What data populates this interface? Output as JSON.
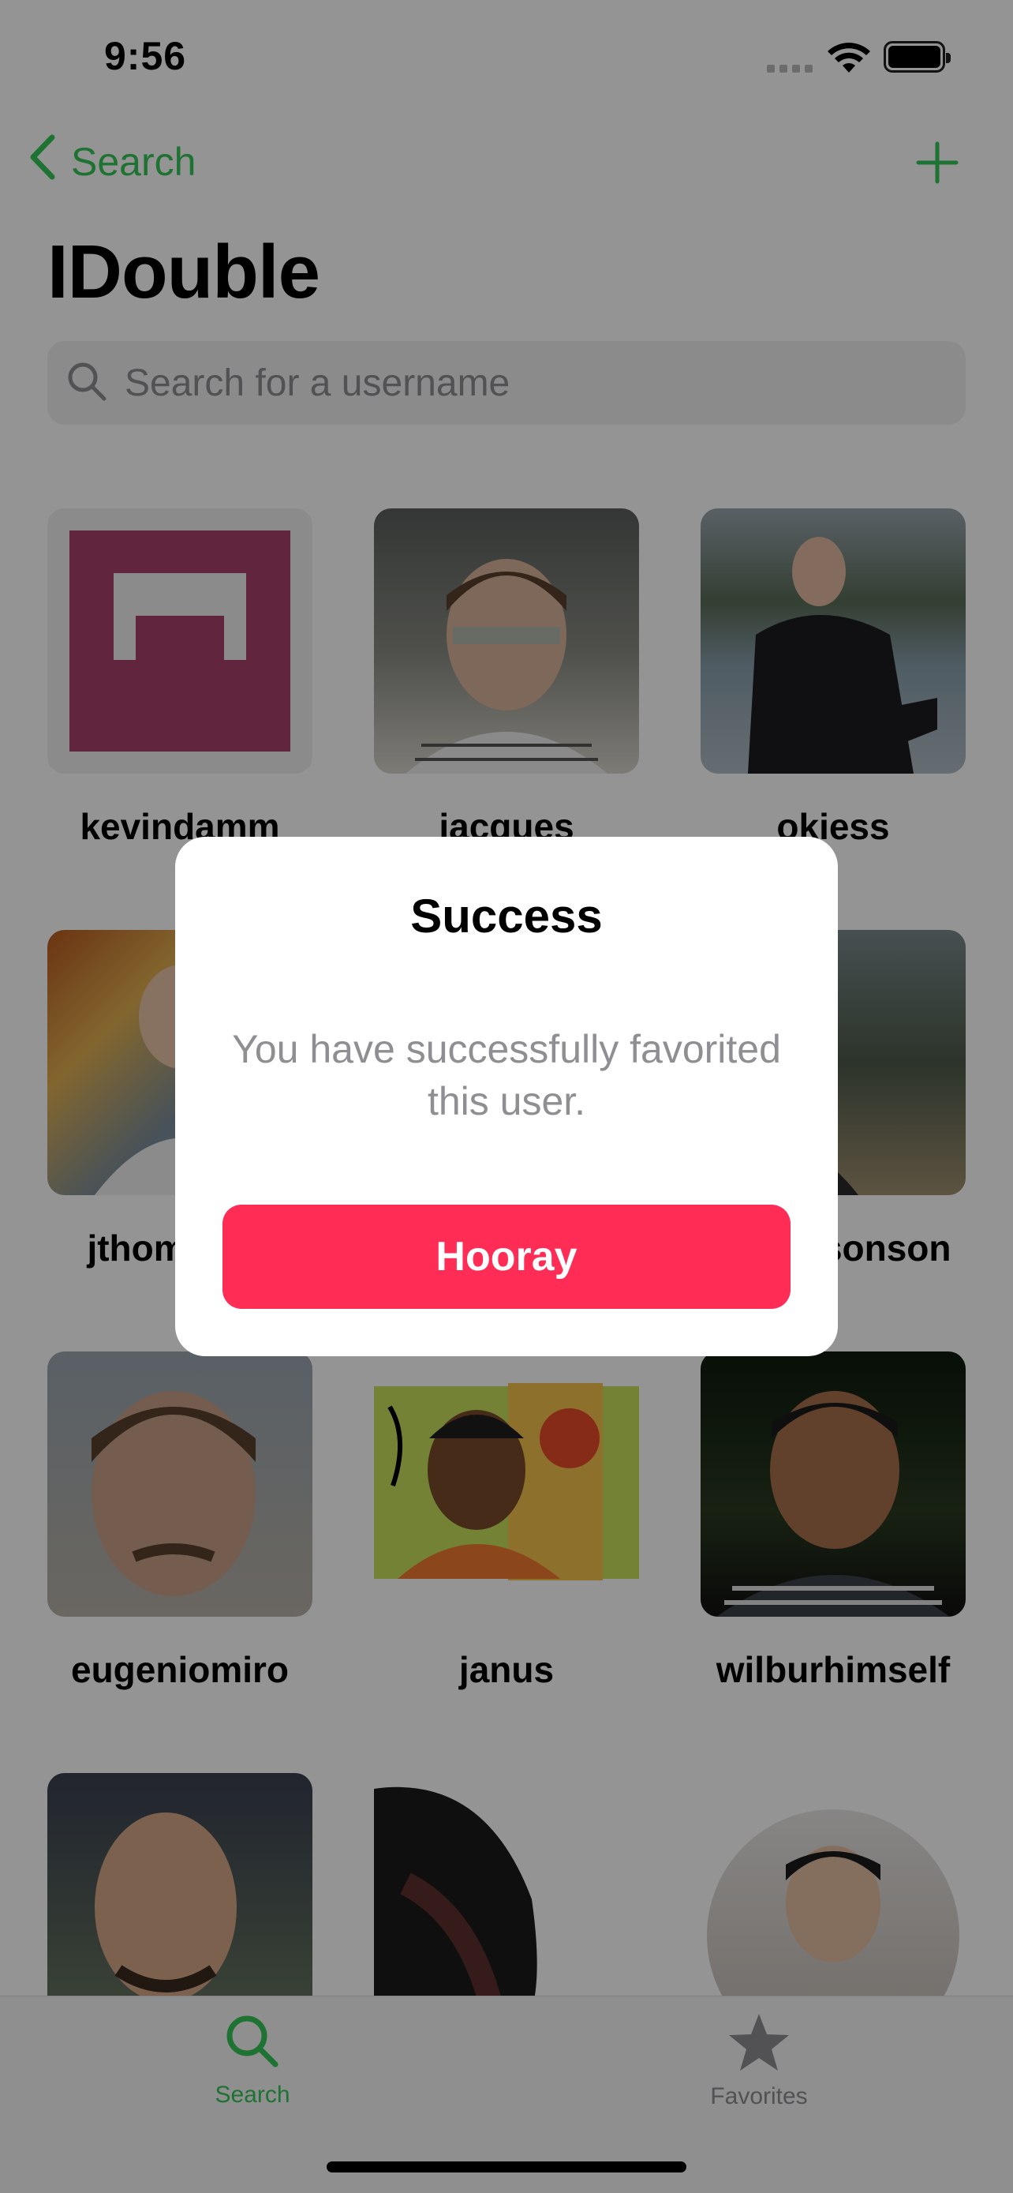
{
  "status_bar": {
    "time": "9:56"
  },
  "nav": {
    "back_label": "Search",
    "title": "IDouble"
  },
  "search": {
    "placeholder": "Search for a username"
  },
  "users": [
    {
      "name": "kevindamm"
    },
    {
      "name": "jacques"
    },
    {
      "name": "okiess"
    },
    {
      "name": "jthompson"
    },
    {
      "name": ""
    },
    {
      "name": "nicholsonson"
    },
    {
      "name": "eugeniomiro"
    },
    {
      "name": "janus"
    },
    {
      "name": "wilburhimself"
    },
    {
      "name": ""
    },
    {
      "name": ""
    },
    {
      "name": ""
    }
  ],
  "tabs": [
    {
      "label": "Search",
      "icon": "search-icon",
      "selected": true
    },
    {
      "label": "Favorites",
      "icon": "star-icon",
      "selected": false
    }
  ],
  "alert": {
    "title": "Success",
    "message": "You have successfully favorited this user.",
    "button_label": "Hooray"
  },
  "colors": {
    "accent": "#34c759",
    "alert_button": "#ff2d55",
    "identicon": "#a8416b"
  }
}
